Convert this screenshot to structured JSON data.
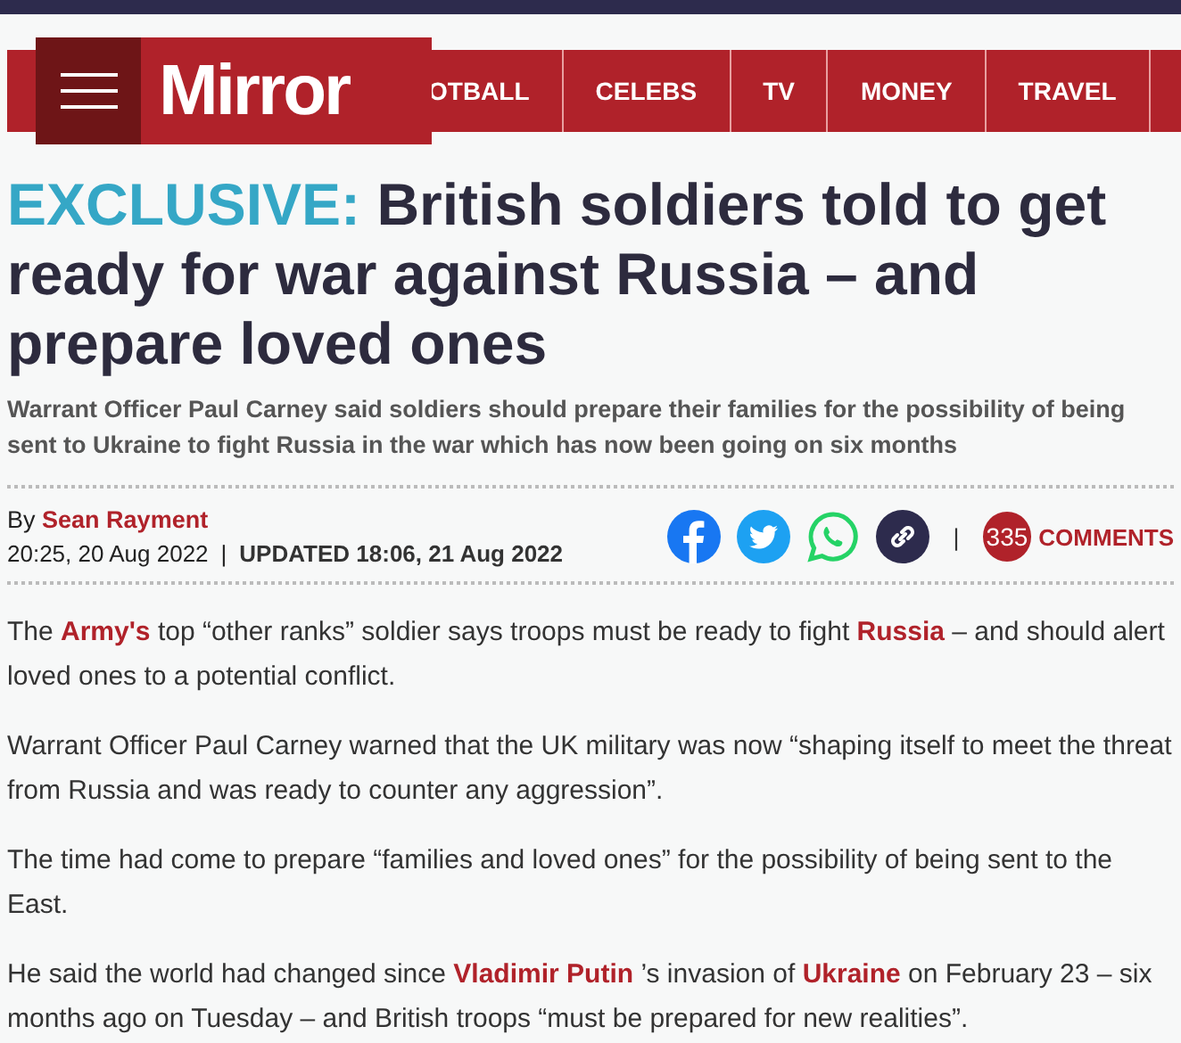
{
  "header": {
    "logo": "Mirror",
    "nav": [
      {
        "label": "OTBALL"
      },
      {
        "label": "CELEBS"
      },
      {
        "label": "TV"
      },
      {
        "label": "MONEY"
      },
      {
        "label": "TRAVEL"
      }
    ]
  },
  "article": {
    "kicker": "EXCLUSIVE:",
    "headline": "British soldiers told to get ready for war against Russia – and prepare loved ones",
    "standfirst": "Warrant Officer Paul Carney said soldiers should prepare their families for the possibility of being sent to Ukraine to fight Russia in the war which has now been going on six months",
    "byline_prefix": "By",
    "author": "Sean Rayment",
    "published": "20:25, 20 Aug 2022",
    "separator": "|",
    "updated": "UPDATED 18:06, 21 Aug 2022",
    "share_separator": "|",
    "comment_count": "335",
    "comments_label": "COMMENTS",
    "paragraphs": [
      [
        {
          "text": "The "
        },
        {
          "text": "Army's",
          "link": true
        },
        {
          "text": " top “other ranks” soldier says troops must be ready to fight "
        },
        {
          "text": "Russia",
          "link": true
        },
        {
          "text": " – and should alert loved ones to a potential conflict."
        }
      ],
      [
        {
          "text": "Warrant Officer Paul Carney warned that the UK military was now “shaping itself to meet the threat from Russia and was ready to counter any aggression”."
        }
      ],
      [
        {
          "text": "The time had come to prepare “families and loved ones” for the possibility of being sent to the East."
        }
      ],
      [
        {
          "text": "He said the world had changed since "
        },
        {
          "text": "Vladimir Putin",
          "link": true
        },
        {
          "text": " ’s invasion of "
        },
        {
          "text": "Ukraine",
          "link": true
        },
        {
          "text": " on February 23 – six months ago on Tuesday – and British troops “must be prepared for new realities”."
        }
      ]
    ]
  }
}
